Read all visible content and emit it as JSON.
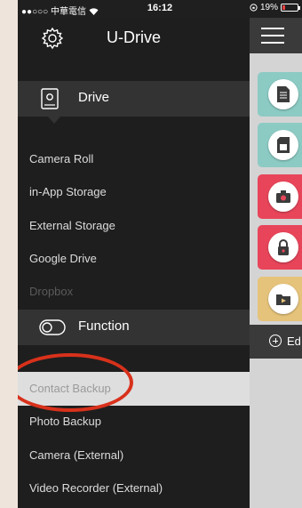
{
  "status_bar": {
    "carrier": "●●○○○ 中華電信",
    "time": "16:12",
    "battery": "19%",
    "battery_level": 0.19
  },
  "header": {
    "title": "U-Drive"
  },
  "sections": {
    "drive": "Drive",
    "function": "Function"
  },
  "drive_items": [
    {
      "label": "Camera Roll"
    },
    {
      "label": "in-App Storage"
    },
    {
      "label": "External Storage"
    },
    {
      "label": "Google Drive"
    },
    {
      "label": "Dropbox"
    }
  ],
  "function_items": [
    {
      "label": "Contact Backup"
    },
    {
      "label": "Photo Backup"
    },
    {
      "label": "Camera (External)"
    },
    {
      "label": "Video Recorder (External)"
    }
  ],
  "right_panel": {
    "edit_label": "Ed",
    "tiles": [
      {
        "icon": "document-icon",
        "color": "#8ccbc4"
      },
      {
        "icon": "sd-card-icon",
        "color": "#8ccbc4"
      },
      {
        "icon": "camera-icon",
        "color": "#e8455a"
      },
      {
        "icon": "lock-icon",
        "color": "#e8455a"
      },
      {
        "icon": "video-folder-icon",
        "color": "#e6c37a"
      }
    ]
  },
  "colors": {
    "highlight_ring": "#d8311b",
    "selected_row": "#dedede"
  }
}
